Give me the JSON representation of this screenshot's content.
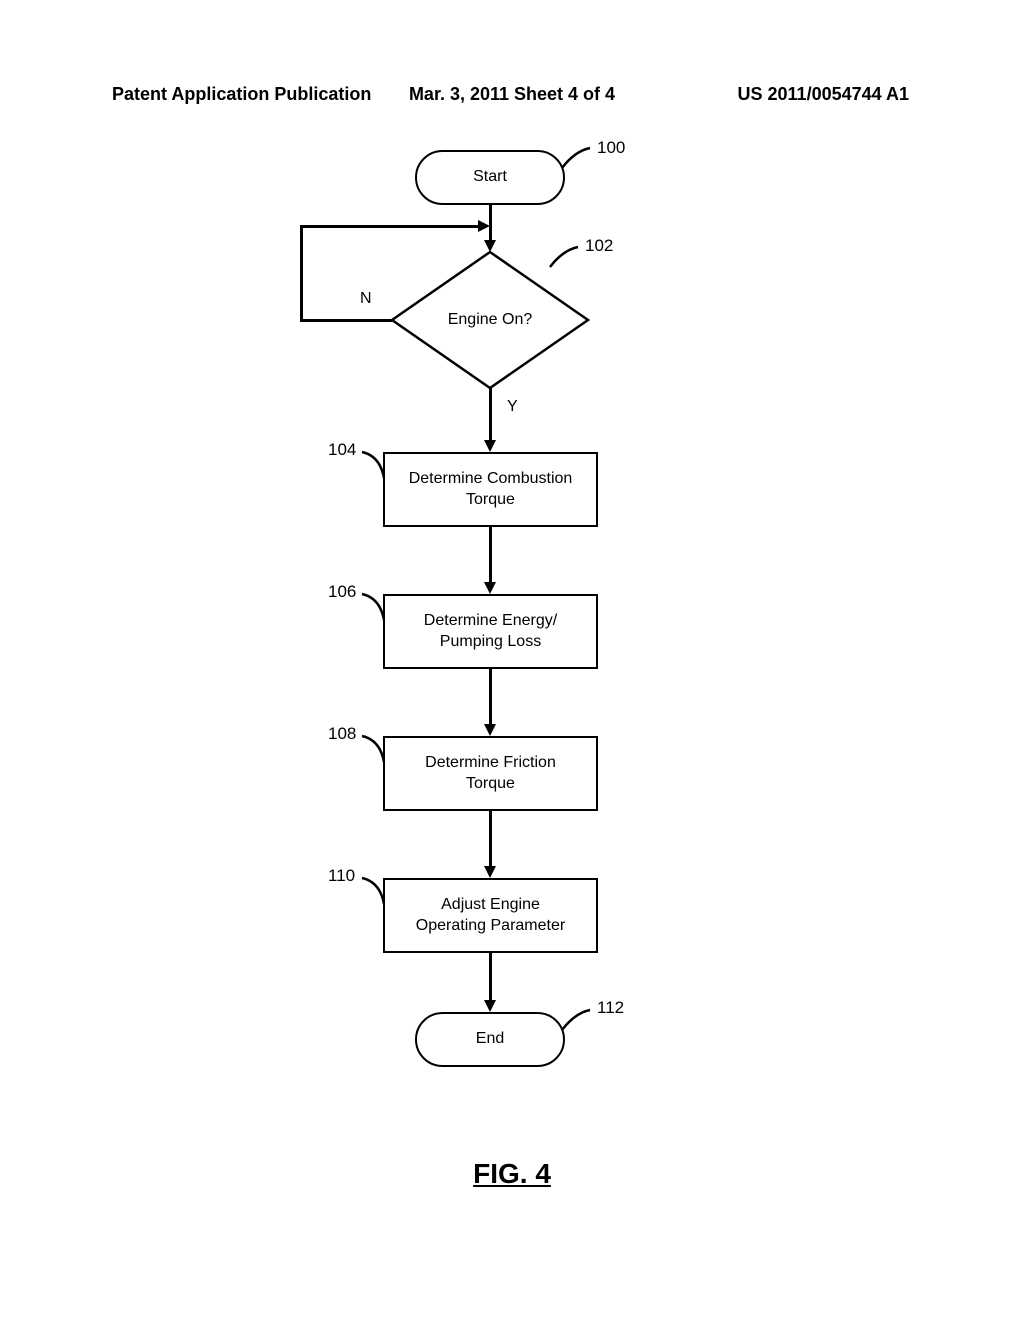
{
  "header": {
    "left": "Patent Application Publication",
    "center": "Mar. 3, 2011  Sheet 4 of 4",
    "right": "US 2011/0054744 A1"
  },
  "nodes": {
    "start": {
      "label": "Start",
      "ref": "100"
    },
    "decision": {
      "label": "Engine On?",
      "ref": "102",
      "yes": "Y",
      "no": "N"
    },
    "step1": {
      "label": "Determine Combustion\nTorque",
      "ref": "104"
    },
    "step2": {
      "label": "Determine Energy/\nPumping Loss",
      "ref": "106"
    },
    "step3": {
      "label": "Determine Friction\nTorque",
      "ref": "108"
    },
    "step4": {
      "label": "Adjust Engine\nOperating Parameter",
      "ref": "110"
    },
    "end": {
      "label": "End",
      "ref": "112"
    }
  },
  "figure_label": "FIG. 4"
}
